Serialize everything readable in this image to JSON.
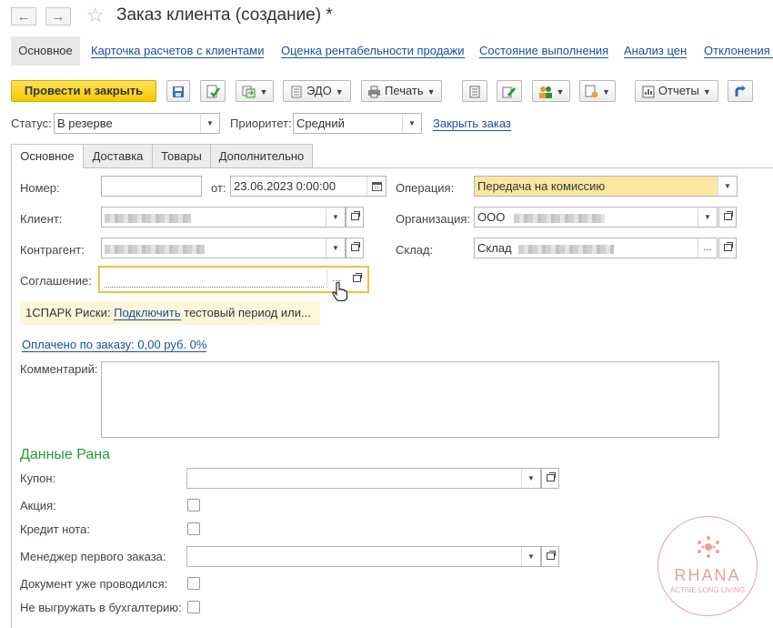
{
  "window": {
    "title": "Заказ клиента (создание) *"
  },
  "nav": {
    "back": "←",
    "forward": "→"
  },
  "top_tabs": [
    {
      "label": "Основное"
    },
    {
      "label": "Карточка расчетов с клиентами"
    },
    {
      "label": "Оценка рентабельности продажи"
    },
    {
      "label": "Состояние выполнения"
    },
    {
      "label": "Анализ цен"
    },
    {
      "label": "Отклонения о"
    }
  ],
  "toolbar": {
    "post_close": "Провести и закрыть",
    "edo": "ЭДО",
    "print": "Печать",
    "reports": "Отчеты"
  },
  "status_row": {
    "status_label": "Статус:",
    "status_value": "В резерве",
    "priority_label": "Приоритет:",
    "priority_value": "Средний",
    "close_order": "Закрыть заказ"
  },
  "form_tabs": [
    {
      "label": "Основное"
    },
    {
      "label": "Доставка"
    },
    {
      "label": "Товары"
    },
    {
      "label": "Дополнительно"
    }
  ],
  "form": {
    "number_label": "Номер:",
    "number_value": "",
    "from_label": "от:",
    "date_value": "23.06.2023  0:00:00",
    "operation_label": "Операция:",
    "operation_value": "Передача на комиссию",
    "client_label": "Клиент:",
    "org_label": "Организация:",
    "org_value": "ООО",
    "contractor_label": "Контрагент:",
    "warehouse_label": "Склад:",
    "warehouse_value": "Склад",
    "agreement_label": "Соглашение:",
    "agreement_value": "",
    "more_dots": "...",
    "spark_prefix": "1СПАРК Риски:",
    "spark_link": "Подключить",
    "spark_suffix": "тестовый период или...",
    "paid_link": "Оплачено по заказу: 0,00 руб. 0%",
    "comment_label": "Комментарий:"
  },
  "rana": {
    "heading": "Данные Рана",
    "coupon_label": "Купон:",
    "action_label": "Акция:",
    "credit_label": "Кредит нота:",
    "manager_label": "Менеджер первого заказа:",
    "posted_label": "Документ уже проводился:",
    "no_export_label": "Не выгружать в бухгалтерию:"
  },
  "watermark": {
    "brand": "RHANA",
    "tagline": "ACTIVE LONG LIVING"
  },
  "colors": {
    "accent_yellow": "#f5c800",
    "link_blue": "#1a4f9c",
    "section_green": "#2a9a3c",
    "highlight_field": "#fde6a4",
    "watermark": "#e98f8f"
  }
}
